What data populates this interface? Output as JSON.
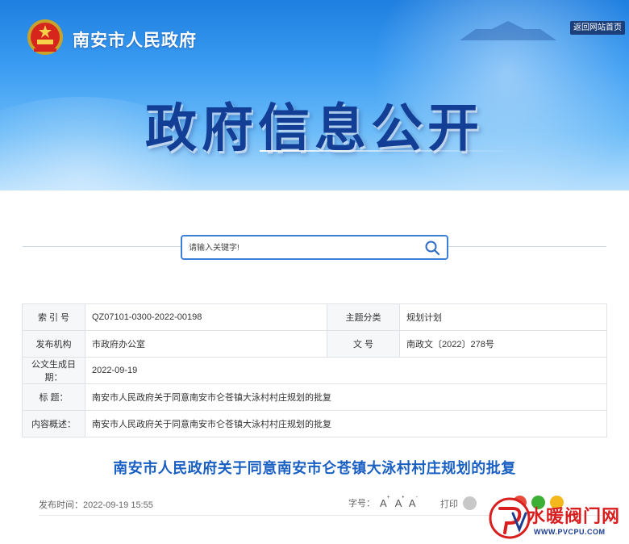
{
  "header": {
    "site_name": "南安市人民政府",
    "home_link": "返回网站首页",
    "banner_title": "政府信息公开"
  },
  "search": {
    "placeholder": "请输入关键字!"
  },
  "info": {
    "rows": [
      {
        "label1": "索 引 号",
        "value1": "QZ07101-0300-2022-00198",
        "label2": "主题分类",
        "value2": "规划计划"
      },
      {
        "label1": "发布机构",
        "value1": "市政府办公室",
        "label2": "文 号",
        "value2": "南政文〔2022〕278号"
      }
    ],
    "date_label": "公文生成日期：",
    "date_value": "2022-09-19",
    "title_label": "标    题：",
    "title_value": "南安市人民政府关于同意南安市仑苍镇大泳村村庄规划的批复",
    "summary_label": "内容概述：",
    "summary_value": "南安市人民政府关于同意南安市仑苍镇大泳村村庄规划的批复"
  },
  "article": {
    "title": "南安市人民政府关于同意南安市仑苍镇大泳村村庄规划的批复",
    "publish_time": "发布时间：2022-09-19 15:55",
    "font_size_label": "字号：",
    "font_a": "A",
    "print_label": "打印"
  },
  "watermark": {
    "text": "水暖阀门网",
    "url": "WWW.PVCPU.COM"
  },
  "colors": {
    "accent": "#1a5fc2",
    "banner_text": "#123f95",
    "home_button": "#1b3f7a"
  }
}
